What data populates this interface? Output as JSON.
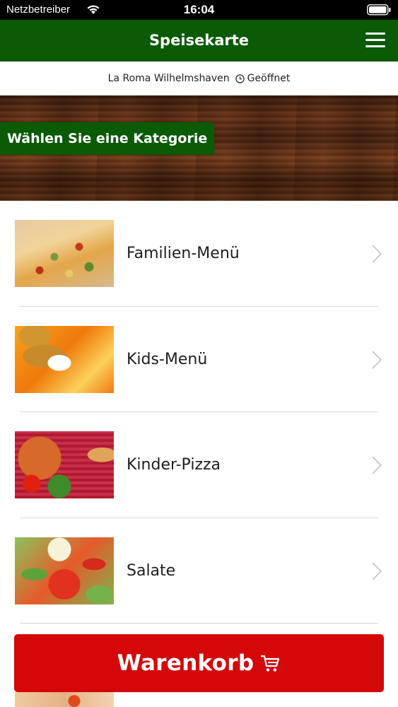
{
  "status_bar": {
    "carrier": "Netzbetreiber",
    "time": "16:04"
  },
  "nav": {
    "title": "Speisekarte"
  },
  "info": {
    "restaurant": "La Roma Wilhelmshaven",
    "status": "Geöffnet"
  },
  "banner": {
    "label": "Wählen Sie eine Kategorie"
  },
  "categories": [
    {
      "label": "Familien-Menü"
    },
    {
      "label": "Kids-Menü"
    },
    {
      "label": "Kinder-Pizza"
    },
    {
      "label": "Salate"
    }
  ],
  "cart": {
    "label": "Warenkorb"
  },
  "colors": {
    "brand_green": "#0a5a06",
    "cart_red": "#d40808"
  }
}
